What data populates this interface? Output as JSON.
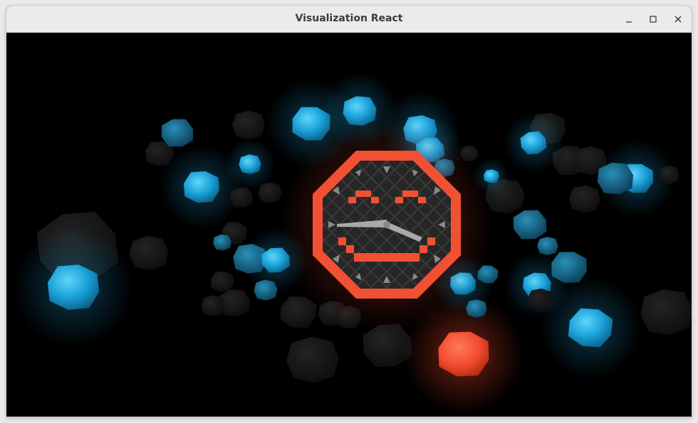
{
  "window": {
    "title": "Visualization React",
    "controls": [
      "minimize",
      "maximize",
      "close"
    ]
  },
  "scene": {
    "background": "#000000",
    "colors": {
      "blue": "#1ea3dc",
      "blue_light": "#56d0f5",
      "dark": "#141414",
      "accent": "#f25033",
      "accent_glow": "#ff5a3c",
      "marker": "#8a8a8a"
    },
    "central_icon": "smiley-clock-octagon-icon"
  }
}
